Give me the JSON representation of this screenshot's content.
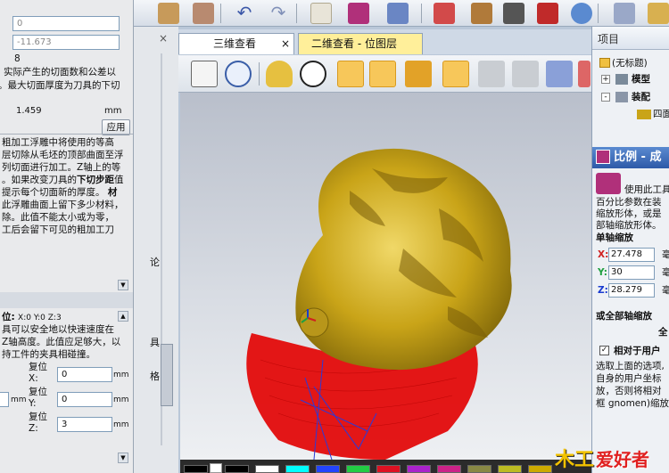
{
  "left_panel": {
    "field_top_1": "0",
    "field_top_2": "-11.673",
    "value_8": "8",
    "text_lines_a": [
      "实际产生的切面数和公差以",
      "。最大切面厚度为刀具的下切"
    ],
    "thickness_value": "1.459",
    "thickness_unit": "mm",
    "apply_button": "应用",
    "text_lines_b": [
      "粗加工浮雕中将使用的等高",
      "层切除从毛坯的顶部曲面至浮",
      "列切面进行加工。Z轴上的等",
      "。如果改变刀具的",
      "提示每个切面新的厚度。",
      "此浮雕曲面上留下多少材料，",
      "除。此值不能太小或为零，",
      "工后会留下可见的粗加工刀"
    ],
    "bold_inline_1": "下切步距",
    "bold_inline_1_after": "值",
    "bold_inline_2": "材",
    "pos_header": "位:",
    "pos_coords": "X:0 Y:0 Z:3",
    "text_lines_c": [
      "具可以安全地以快速速度在",
      "Z轴高度。此值应足够大，以",
      "持工件的夹具相碰撞。"
    ],
    "pos_x_label": "复位\nX:",
    "pos_x_value": "0",
    "pos_y_label": "复位\nY:",
    "pos_y_value": "0",
    "pos_z_label": "复位\nZ:",
    "pos_z_value": "3",
    "unit_mm": "mm",
    "stub_mm": "mm"
  },
  "mid_strip": {
    "close_x": "×",
    "edge_labels": [
      "论",
      "具",
      "格"
    ]
  },
  "tabs": [
    {
      "label": "三维查看",
      "close": "×",
      "active": true
    },
    {
      "label": "二维查看 - 位图层",
      "active": false
    }
  ],
  "right_panel": {
    "header": "项目",
    "tree": [
      {
        "label": "(无标题)",
        "indent": 0
      },
      {
        "label": "模型",
        "indent": 1,
        "toggle": "+"
      },
      {
        "label": "装配",
        "indent": 1,
        "toggle": "-"
      },
      {
        "label": "四面",
        "indent": 2
      }
    ],
    "section_title": "比例 - 成",
    "desc_lines": [
      "使用此工具",
      "百分比参数在装",
      "缩放形体，或是",
      "部轴缩放形体。"
    ],
    "single_axis_label": "单轴缩放",
    "x_label": "X:",
    "x_value": "27.478",
    "y_label": "Y:",
    "y_value": "30",
    "z_label": "Z:",
    "z_value": "28.279",
    "unit": "毫",
    "all_axis_label": "或全部轴缩放",
    "all_value_stub": "全",
    "relative_label": "相对于用户",
    "check": "✓",
    "note_lines": [
      "选取上面的选项,",
      "自身的用户坐标",
      "放，否则将相对",
      "框 gnomen)缩放"
    ]
  },
  "palette": [
    "#000000",
    "#ffffff",
    "#00ffff",
    "#2244ff",
    "#22cc44",
    "#dd1122",
    "#aa22cc",
    "#cc2288",
    "#888844",
    "#bbbb22",
    "#ccaa00"
  ],
  "watermark": {
    "part1": "木工",
    "part2": "爱好者"
  },
  "colors": {
    "gold": "#c9a418",
    "red": "#e30b0b",
    "tab_active": "#ffffff",
    "tab_inactive": "#ffef9a"
  }
}
